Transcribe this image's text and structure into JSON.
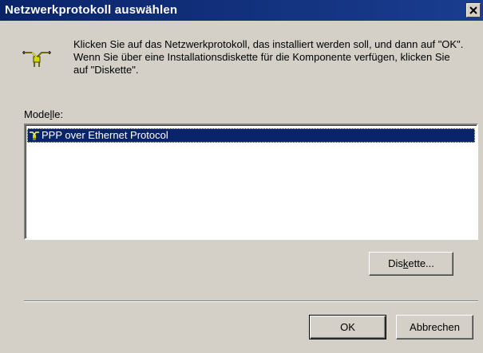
{
  "window": {
    "title": "Netzwerkprotokoll auswählen",
    "close_label": "close"
  },
  "instructions": {
    "text": "Klicken Sie auf das Netzwerkprotokoll, das installiert werden soll, und dann auf \"OK\". Wenn Sie über eine Installationsdiskette für die Komponente verfügen, klicken Sie auf \"Diskette\"."
  },
  "list": {
    "label_pre": "Mode",
    "label_accel": "l",
    "label_post": "le:",
    "items": [
      {
        "label": "PPP over Ethernet Protocol",
        "selected": true
      }
    ]
  },
  "buttons": {
    "disk_pre": "Dis",
    "disk_accel": "k",
    "disk_post": "ette...",
    "ok": "OK",
    "cancel": "Abbrechen"
  },
  "colors": {
    "title_bar": "#0a246a",
    "selection": "#0a246a",
    "face": "#d4d0c8"
  },
  "icons": {
    "protocol": "network-protocol-icon",
    "close": "close-icon"
  }
}
